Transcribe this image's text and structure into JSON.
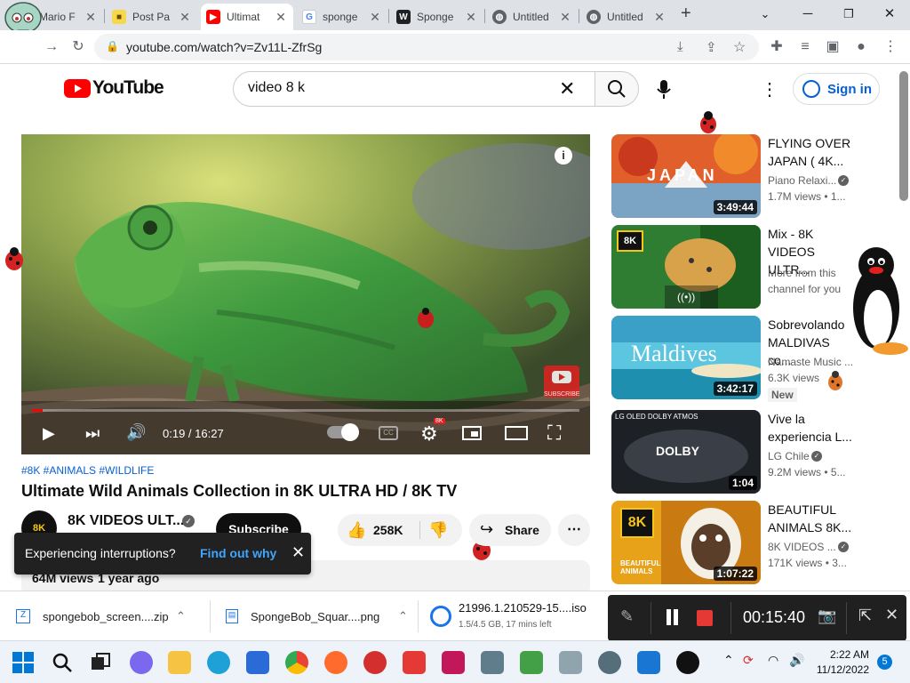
{
  "browser": {
    "tabs": [
      {
        "title": "Mario F",
        "fav": "squidward-icon"
      },
      {
        "title": "Post Pa",
        "fav": "spongebob-icon"
      },
      {
        "title": "Ultimat",
        "fav": "youtube-icon",
        "active": true
      },
      {
        "title": "sponge",
        "fav": "google-icon"
      },
      {
        "title": "Sponge",
        "fav": "wiki-icon"
      },
      {
        "title": "Untitled",
        "fav": "globe-icon"
      },
      {
        "title": "Untitled",
        "fav": "globe-icon"
      }
    ],
    "url": "youtube.com/watch?v=Zv11L-ZfrSg"
  },
  "youtube": {
    "logo_text": "YouTube",
    "search_value": "video 8 k",
    "signin_label": "Sign in"
  },
  "player": {
    "time": "0:19 / 16:27",
    "progress": 0.019,
    "quality_badge": "8K",
    "watermark": "SUBSCRIBE"
  },
  "video": {
    "hashtags": "#8K #ANIMALS #WILDLIFE",
    "title": "Ultimate Wild Animals Collection in 8K ULTRA HD / 8K TV",
    "channel": "8K VIDEOS ULT...",
    "subscribe_label": "Subscribe",
    "likes": "258K",
    "share_label": "Share",
    "views": "64M views",
    "age": "1 year ago"
  },
  "toast": {
    "message": "Experiencing interruptions?",
    "link": "Find out why"
  },
  "recommendations": [
    {
      "title": "FLYING OVER JAPAN ( 4K...",
      "channel": "Piano Relaxi...",
      "meta": "1.7M views • 1...",
      "duration": "3:49:44",
      "thumb_text": "JAPAN",
      "verified": true
    },
    {
      "title": "Mix - 8K VIDEOS ULTR...",
      "channel": "More from this channel for you",
      "meta": "",
      "duration": "",
      "thumb_text": "8K",
      "verified": false
    },
    {
      "title": "Sobrevolando MALDIVAS co...",
      "channel": "Namaste Music ...",
      "meta": "6.3K views",
      "badge": "New",
      "duration": "3:42:17",
      "thumb_text": "Maldives",
      "verified": false
    },
    {
      "title": "Vive la experiencia L...",
      "channel": "LG Chile",
      "meta": "9.2M views • 5...",
      "duration": "1:04",
      "thumb_text": "DOLBY",
      "thumb_top": "LG OLED DOLBY ATMOS",
      "verified": true
    },
    {
      "title": "BEAUTIFUL ANIMALS 8K...",
      "channel": "8K VIDEOS ...",
      "meta": "171K views • 3...",
      "duration": "1:07:22",
      "thumb_text": "8K",
      "thumb_sub": "BEAUTIFUL ANIMALS",
      "verified": true
    }
  ],
  "downloads": [
    {
      "name": "spongebob_screen....zip"
    },
    {
      "name": "SpongeBob_Squar....png"
    },
    {
      "name": "21996.1.210529-15....iso",
      "status": "1.5/4.5 GB, 17 mins left"
    }
  ],
  "recorder": {
    "timer": "00:15:40"
  },
  "taskbar": {
    "time": "2:22 AM",
    "date": "11/12/2022",
    "notifications": "5"
  },
  "colors": {
    "yt_red": "#ff0000",
    "link_blue": "#065fd4",
    "hashtag_blue": "#065fd4",
    "progress_red": "#ff0000"
  }
}
